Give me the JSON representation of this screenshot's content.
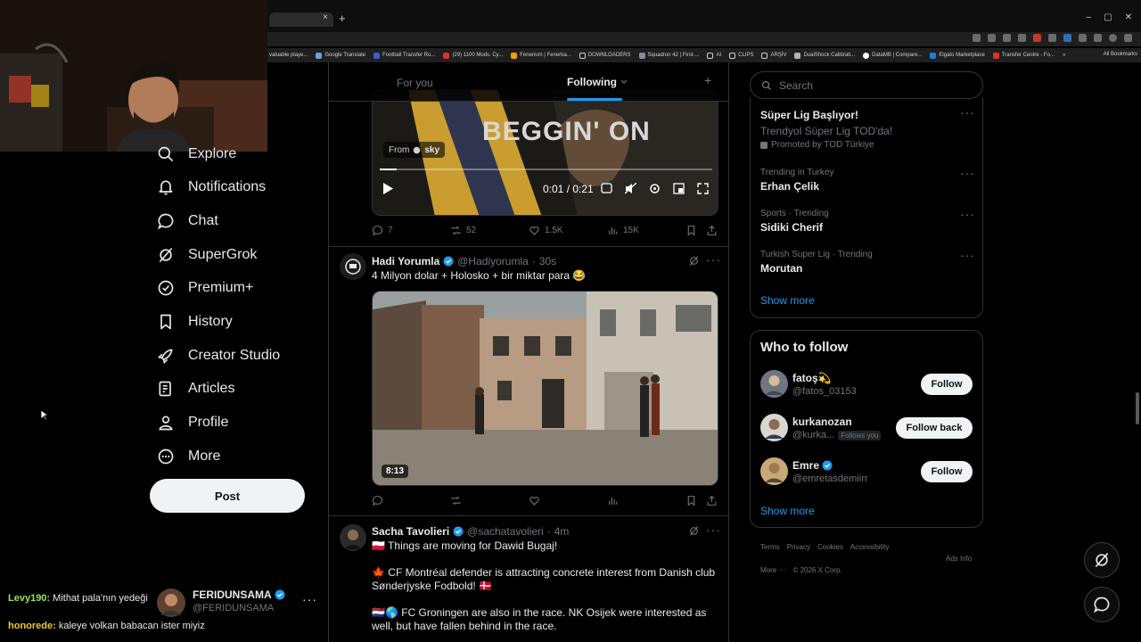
{
  "browser": {
    "window_controls": [
      "–",
      "▢",
      "✕"
    ],
    "tab_close": "×",
    "new_tab": "+",
    "bookmarks": [
      "valuable playe...",
      "Google Translate",
      "Football Transfer Ru...",
      "(29) 1100 Mods. Cy...",
      "Fenerium | Fenerba...",
      "DOWNLOADERS",
      "Squadron 42 | First-...",
      "AI",
      "CLIPS",
      "ARŞİV",
      "DualShock Calibrati...",
      "DataMB | Compare...",
      "Elgato Marketplace",
      "Transfer Centre - Fo..."
    ],
    "bookmarks_more": "»",
    "all_bookmarks": "All Bookmarks"
  },
  "nav": {
    "items": [
      {
        "label": "Explore",
        "icon": "search-icon"
      },
      {
        "label": "Notifications",
        "icon": "bell-icon"
      },
      {
        "label": "Chat",
        "icon": "chat-bubble-icon"
      },
      {
        "label": "SuperGrok",
        "icon": "grok-icon"
      },
      {
        "label": "Premium+",
        "icon": "verified-badge-icon"
      },
      {
        "label": "History",
        "icon": "bookmark-icon"
      },
      {
        "label": "Creator Studio",
        "icon": "rocket-icon"
      },
      {
        "label": "Articles",
        "icon": "article-icon"
      },
      {
        "label": "Profile",
        "icon": "person-icon"
      },
      {
        "label": "More",
        "icon": "more-circle-icon"
      }
    ],
    "post_label": "Post"
  },
  "account": {
    "name": "FERIDUNSAMA",
    "handle": "@FERIDUNSAMA",
    "more": "···"
  },
  "stream_chat": [
    {
      "user": "Levy190:",
      "message": "Mithat pala'nın yedeği",
      "color": "#9ae64d"
    },
    {
      "user": "honorede:",
      "message": "kaleye volkan babacan ister miyiz",
      "color": "#f0c930"
    }
  ],
  "timeline": {
    "tabs": {
      "for_you": "For you",
      "following": "Following",
      "add": "+"
    },
    "video": {
      "overlay_text": "BEGGIN' ON",
      "from_label": "From",
      "from_source": "sky",
      "time": "0:01 / 0:21",
      "progress": 0.05
    },
    "post1_actions": {
      "replies": "7",
      "reposts": "52",
      "likes": "1.5K",
      "views": "15K"
    },
    "post2": {
      "name": "Hadi Yorumla",
      "handle": "@Hadiyorumla",
      "time": "30s",
      "text": "4 Milyon dolar + Holosko + bir miktar para 😂",
      "duration": "8:13"
    },
    "post3": {
      "name": "Sacha Tavolieri",
      "handle": "@sachatavolieri",
      "time": "4m",
      "lines": [
        "🇵🇱 Things are moving for Dawid Bugaj!",
        "🍁 CF Montréal defender is attracting concrete interest from Danish club Sønderjyske Fodbold! 🇩🇰",
        "🇳🇱🌎 FC Groningen are also in the race. NK Osijek were interested as well, but have fallen behind in the race."
      ]
    },
    "separator": "·"
  },
  "sidebar": {
    "search_placeholder": "Search",
    "trends": [
      {
        "name": "Süper Lig Başlıyor!",
        "subtitle": "Trendyol Süper Lig TOD'da!",
        "promoted": "Promoted by TOD Türkiye"
      },
      {
        "context": "Trending in Turkey",
        "name": "Erhan Çelik"
      },
      {
        "context": "Sports · Trending",
        "name": "Sidiki Cherif"
      },
      {
        "context": "Turkish Super Lig · Trending",
        "name": "Morutan"
      }
    ],
    "trends_show_more": "Show more",
    "who_to_follow_title": "Who to follow",
    "follow_suggestions": [
      {
        "name": "fatoş💫",
        "handle": "@fatos_03153",
        "button": "Follow"
      },
      {
        "name": "kurkanozan",
        "handle": "@kurka...",
        "badge": "Follows you",
        "button": "Follow back"
      },
      {
        "name": "Emre",
        "handle": "@emretasdemiirr",
        "button": "Follow"
      }
    ],
    "wtf_show_more": "Show more",
    "footer": [
      "Terms",
      "Privacy",
      "Cookies",
      "Accessibility",
      "Ads Info",
      "More ···",
      "© 2026 X Corp."
    ]
  },
  "colors": {
    "accent": "#1d9bf0",
    "background": "#000000",
    "border": "#2f3336",
    "muted_text": "#71767b"
  }
}
